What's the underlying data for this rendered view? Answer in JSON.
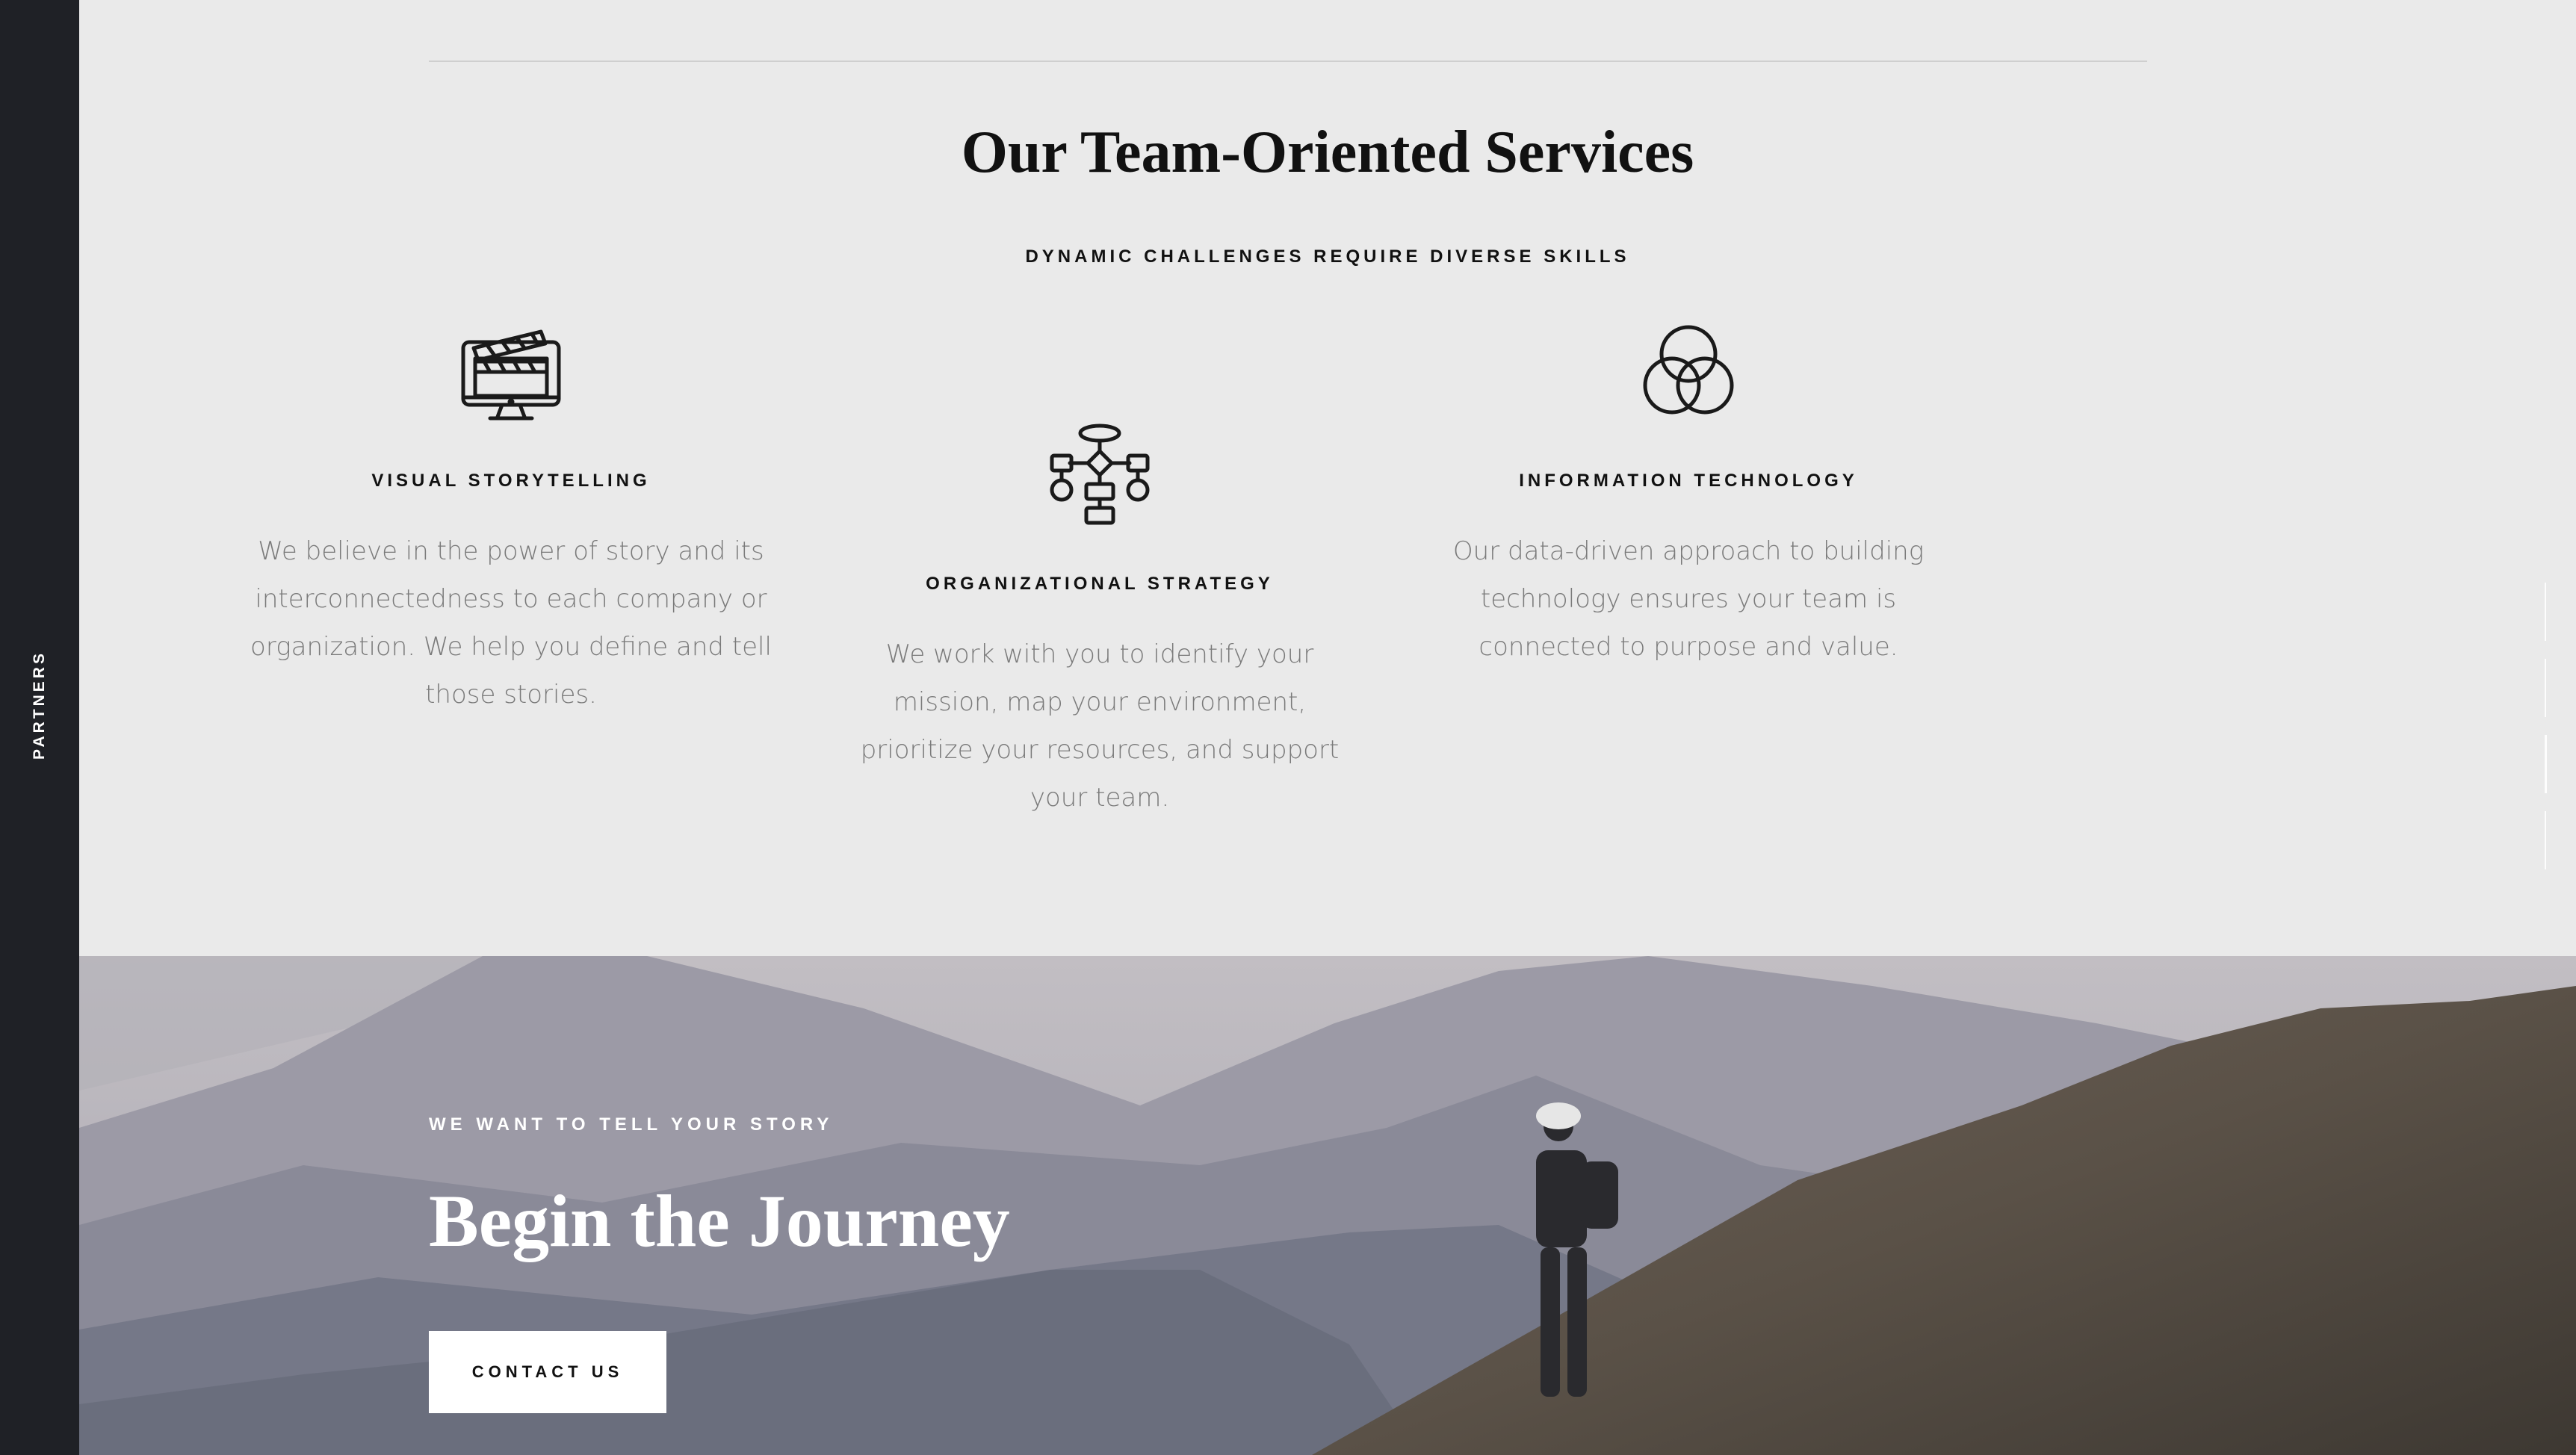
{
  "sidebar": {
    "label": "PARTNERS"
  },
  "services": {
    "title": "Our Team-Oriented Services",
    "subtitle": "DYNAMIC CHALLENGES REQUIRE DIVERSE SKILLS",
    "items": [
      {
        "icon": "film-clapper-monitor-icon",
        "title": "VISUAL STORYTELLING",
        "description": "We believe in the power of story and its interconnectedness to each company or organization. We help you define and tell those stories."
      },
      {
        "icon": "flowchart-icon",
        "title": "ORGANIZATIONAL STRATEGY",
        "description": "We work with you to identify your mission, map your environment, prioritize your resources, and support your team."
      },
      {
        "icon": "overlapping-circles-icon",
        "title": "INFORMATION TECHNOLOGY",
        "description": "Our data-driven approach to building technology ensures your team is connected to purpose and value."
      }
    ]
  },
  "hero": {
    "eyebrow": "WE WANT TO TELL YOUR STORY",
    "title_regular": "Begin the ",
    "title_bold": "Journey",
    "button_label": "CONTACT US"
  },
  "colors": {
    "sidebar_bg": "#1f2126",
    "page_bg": "#eaeaea",
    "heading": "#111111",
    "body_text": "#7a7a7a"
  }
}
